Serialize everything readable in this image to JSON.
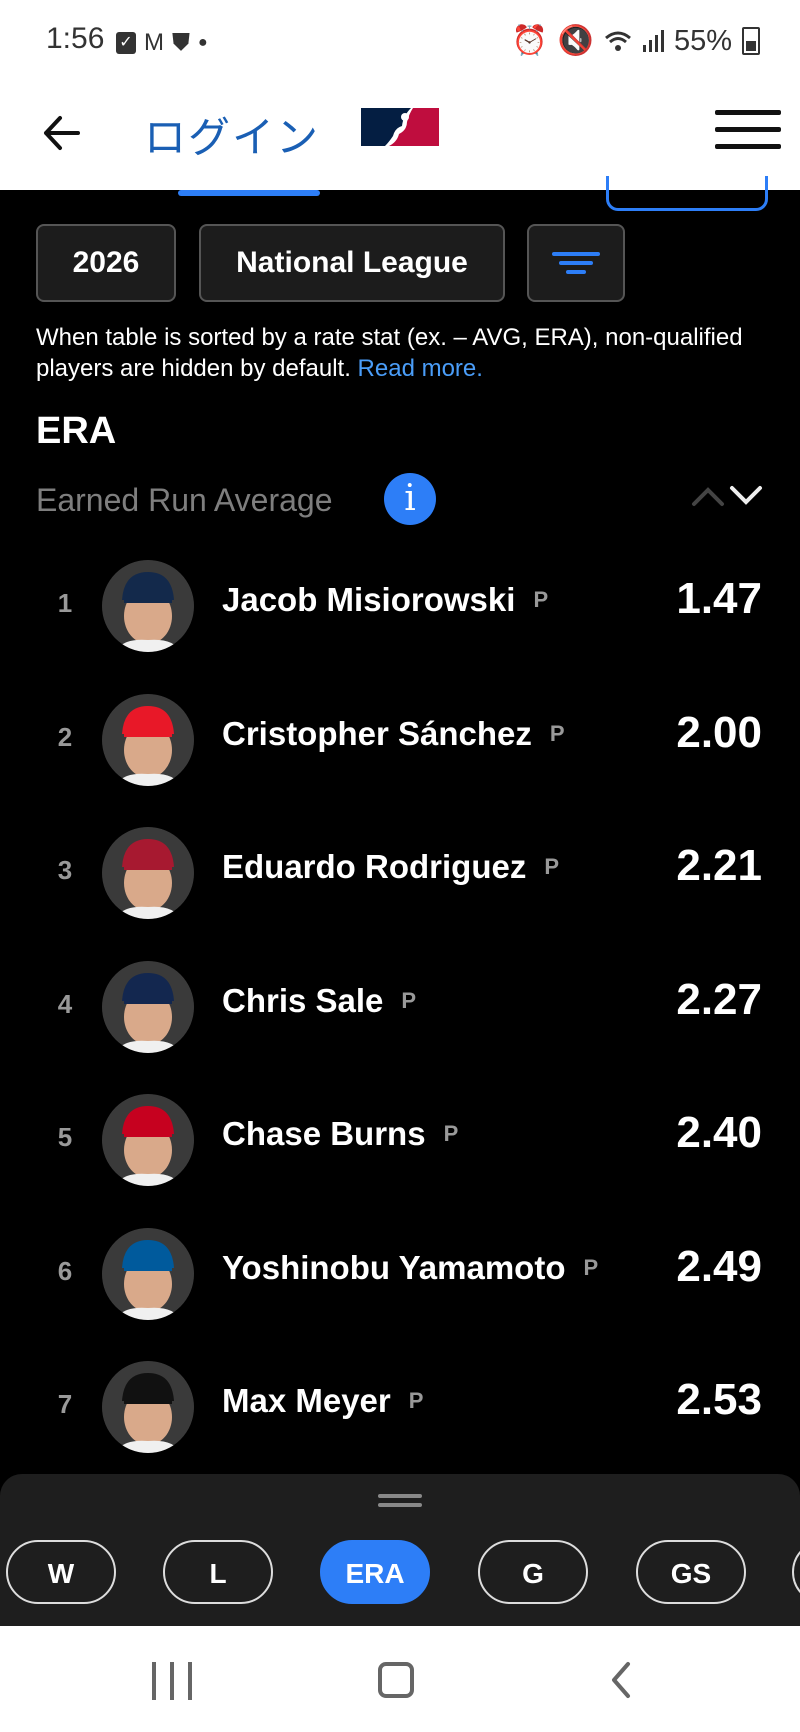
{
  "status_bar": {
    "time": "1:56",
    "battery": "55%"
  },
  "header": {
    "login_label": "ログイン"
  },
  "filters": {
    "year": "2026",
    "league": "National League"
  },
  "note": {
    "text": "When table is sorted by a rate stat (ex. – AVG, ERA), non-qualified players are hidden by default.",
    "link": "Read more."
  },
  "stat": {
    "title": "ERA",
    "subtitle": "Earned Run Average"
  },
  "leaders": [
    {
      "rank": "1",
      "name": "Jacob Misiorowski",
      "pos": "P",
      "value": "1.47",
      "cap_color": "#13294b"
    },
    {
      "rank": "2",
      "name": "Cristopher Sánchez",
      "pos": "P",
      "value": "2.00",
      "cap_color": "#e81828"
    },
    {
      "rank": "3",
      "name": "Eduardo Rodriguez",
      "pos": "P",
      "value": "2.21",
      "cap_color": "#a71930"
    },
    {
      "rank": "4",
      "name": "Chris Sale",
      "pos": "P",
      "value": "2.27",
      "cap_color": "#13274f"
    },
    {
      "rank": "5",
      "name": "Chase Burns",
      "pos": "P",
      "value": "2.40",
      "cap_color": "#c6011f"
    },
    {
      "rank": "6",
      "name": "Yoshinobu Yamamoto",
      "pos": "P",
      "value": "2.49",
      "cap_color": "#005a9c"
    },
    {
      "rank": "7",
      "name": "Max Meyer",
      "pos": "P",
      "value": "2.53",
      "cap_color": "#111111"
    }
  ],
  "stat_chips": [
    "W",
    "L",
    "ERA",
    "G",
    "GS"
  ],
  "active_chip": "ERA"
}
